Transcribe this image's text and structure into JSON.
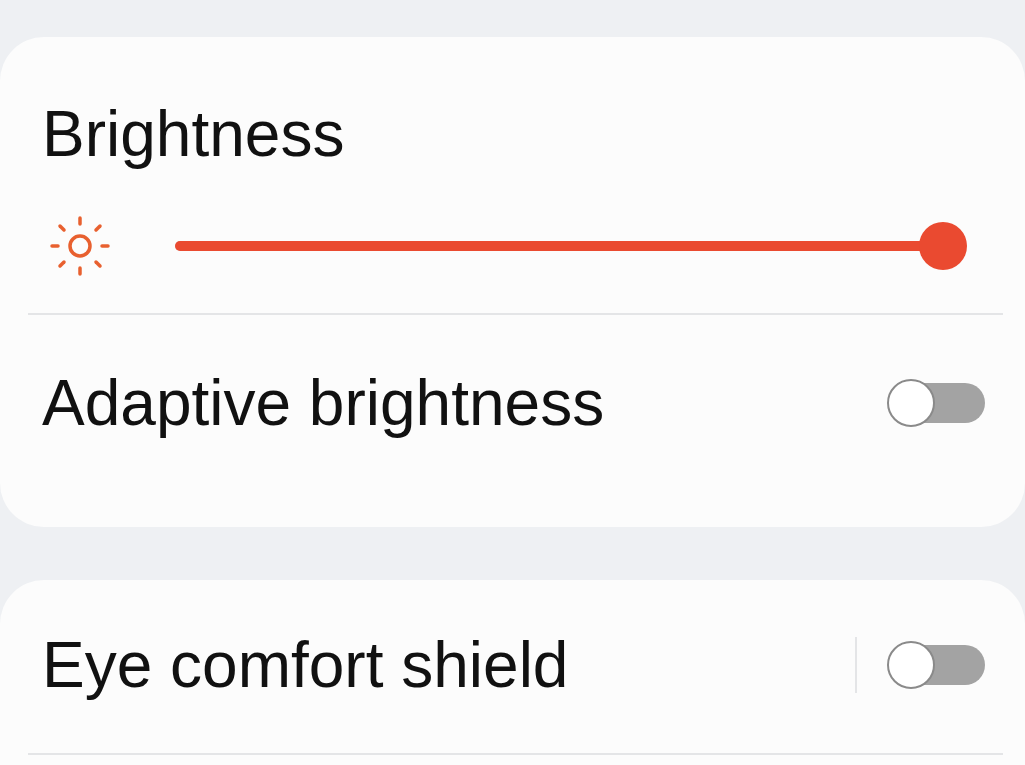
{
  "brightness": {
    "title": "Brightness",
    "level": 1
  },
  "card_1_items": [
    {
      "kind": "switch",
      "label": "Adaptive brightness",
      "on": false,
      "separator": false
    }
  ],
  "card_2_items": [
    {
      "kind": "switch",
      "label": "Eye comfort shield",
      "on": false,
      "separator": true
    }
  ]
}
